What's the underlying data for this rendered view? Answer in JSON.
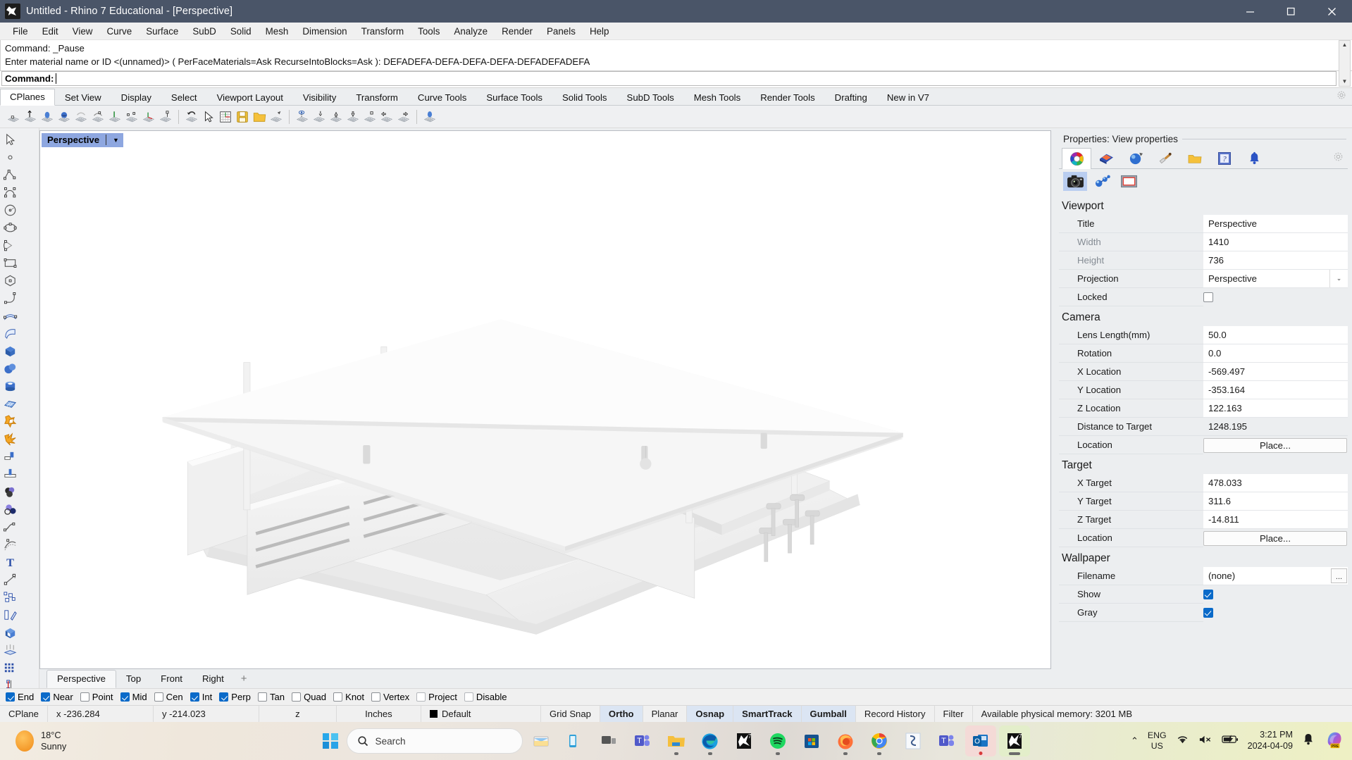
{
  "window": {
    "title": "Untitled - Rhino 7 Educational - [Perspective]",
    "app_icon": "rhino-icon",
    "minimize": "minimize-button",
    "maximize": "maximize-button",
    "close": "close-button"
  },
  "menubar": {
    "items": [
      "File",
      "Edit",
      "View",
      "Curve",
      "Surface",
      "SubD",
      "Solid",
      "Mesh",
      "Dimension",
      "Transform",
      "Tools",
      "Analyze",
      "Render",
      "Panels",
      "Help"
    ]
  },
  "command_area": {
    "history": [
      "Command: _Pause",
      "Enter material name or ID <(unnamed)> ( PerFaceMaterials=Ask  RecurseIntoBlocks=Ask ): DEFADEFA-DEFA-DEFA-DEFA-DEFADEFADEFA"
    ],
    "prompt": "Command:",
    "input_value": ""
  },
  "toolbar_tabs": {
    "active": "CPlanes",
    "items": [
      "CPlanes",
      "Set View",
      "Display",
      "Select",
      "Viewport Layout",
      "Visibility",
      "Transform",
      "Curve Tools",
      "Surface Tools",
      "Solid Tools",
      "SubD Tools",
      "Mesh Tools",
      "Render Tools",
      "Drafting",
      "New in V7"
    ]
  },
  "viewport": {
    "label": "Perspective",
    "tabs": [
      "Perspective",
      "Top",
      "Front",
      "Right"
    ],
    "active_tab": "Perspective",
    "add_tab": "+"
  },
  "properties": {
    "title": "Properties: View properties",
    "tabs": [
      "color-wheel-icon",
      "layer-icon",
      "material-sphere-icon",
      "paintbrush-icon",
      "folder-icon",
      "help-icon",
      "notification-bell-icon"
    ],
    "subtabs": [
      "camera-icon",
      "display-mode-icon",
      "viewport-frame-icon"
    ],
    "sections": [
      {
        "name": "Viewport",
        "rows": [
          {
            "label": "Title",
            "value": "Perspective",
            "type": "text",
            "dim": false
          },
          {
            "label": "Width",
            "value": "1410",
            "type": "text",
            "dim": true
          },
          {
            "label": "Height",
            "value": "736",
            "type": "text",
            "dim": true
          },
          {
            "label": "Projection",
            "value": "Perspective",
            "type": "dropdown",
            "dim": false
          },
          {
            "label": "Locked",
            "value": "",
            "type": "checkbox-off",
            "dim": false
          }
        ]
      },
      {
        "name": "Camera",
        "rows": [
          {
            "label": "Lens Length(mm)",
            "value": "50.0",
            "type": "text",
            "dim": false
          },
          {
            "label": "Rotation",
            "value": "0.0",
            "type": "text",
            "dim": false
          },
          {
            "label": "X Location",
            "value": "-569.497",
            "type": "text",
            "dim": false
          },
          {
            "label": "Y Location",
            "value": "-353.164",
            "type": "text",
            "dim": false
          },
          {
            "label": "Z Location",
            "value": "122.163",
            "type": "text",
            "dim": false
          },
          {
            "label": "Distance to Target",
            "value": "1248.195",
            "type": "readonly",
            "dim": false
          },
          {
            "label": "Location",
            "value": "Place...",
            "type": "button",
            "dim": false
          }
        ]
      },
      {
        "name": "Target",
        "rows": [
          {
            "label": "X Target",
            "value": "478.033",
            "type": "text",
            "dim": false
          },
          {
            "label": "Y Target",
            "value": "311.6",
            "type": "text",
            "dim": false
          },
          {
            "label": "Z Target",
            "value": "-14.811",
            "type": "text",
            "dim": false
          },
          {
            "label": "Location",
            "value": "Place...",
            "type": "button",
            "dim": false
          }
        ]
      },
      {
        "name": "Wallpaper",
        "rows": [
          {
            "label": "Filename",
            "value": "(none)",
            "type": "file",
            "dim": false
          },
          {
            "label": "Show",
            "value": "",
            "type": "checkbox-on",
            "dim": false
          },
          {
            "label": "Gray",
            "value": "",
            "type": "checkbox-on",
            "dim": false
          }
        ]
      }
    ]
  },
  "osnap": {
    "items": [
      {
        "label": "End",
        "checked": true
      },
      {
        "label": "Near",
        "checked": true
      },
      {
        "label": "Point",
        "checked": false
      },
      {
        "label": "Mid",
        "checked": true
      },
      {
        "label": "Cen",
        "checked": false
      },
      {
        "label": "Int",
        "checked": true
      },
      {
        "label": "Perp",
        "checked": true
      },
      {
        "label": "Tan",
        "checked": false
      },
      {
        "label": "Quad",
        "checked": false
      },
      {
        "label": "Knot",
        "checked": false
      },
      {
        "label": "Vertex",
        "checked": false
      },
      {
        "label": "Project",
        "checked": false,
        "pale": true
      },
      {
        "label": "Disable",
        "checked": false,
        "pale": true
      }
    ]
  },
  "statusbar": {
    "cplane": "CPlane",
    "x": "x -236.284",
    "y": "y -214.023",
    "z": "z",
    "units": "Inches",
    "layer": "Default",
    "toggles": [
      {
        "label": "Grid Snap",
        "on": false
      },
      {
        "label": "Ortho",
        "on": true
      },
      {
        "label": "Planar",
        "on": false
      },
      {
        "label": "Osnap",
        "on": true
      },
      {
        "label": "SmartTrack",
        "on": true
      },
      {
        "label": "Gumball",
        "on": true
      },
      {
        "label": "Record History",
        "on": false
      },
      {
        "label": "Filter",
        "on": false
      }
    ],
    "memory": "Available physical memory: 3201 MB"
  },
  "taskbar": {
    "weather_temp": "18°C",
    "weather_desc": "Sunny",
    "start": "windows-start-button",
    "search_placeholder": "Search",
    "apps": [
      "sticky-notes-icon",
      "phone-link-icon",
      "task-view-icon",
      "teams-icon",
      "file-explorer-icon",
      "edge-icon",
      "rhino-icon",
      "spotify-icon",
      "microsoft-store-icon",
      "firefox-icon",
      "chrome-icon",
      "shapr3d-icon",
      "teams-chat-icon",
      "outlook-icon",
      "rhino-active-icon"
    ],
    "tray": {
      "chevron": "show-hidden-icons",
      "lang_line1": "ENG",
      "lang_line2": "US",
      "wifi": "wifi-icon",
      "volume": "volume-muted-icon",
      "battery": "battery-charging-icon",
      "time": "3:21 PM",
      "date": "2024-04-09",
      "notifications": "notification-bell-icon",
      "copilot": "copilot-preview-icon"
    }
  },
  "colors": {
    "titlebar": "#4a5568",
    "accent": "#0a6ac9",
    "vp_label": "#8ea7e0",
    "panel_bg": "#eceef0"
  }
}
